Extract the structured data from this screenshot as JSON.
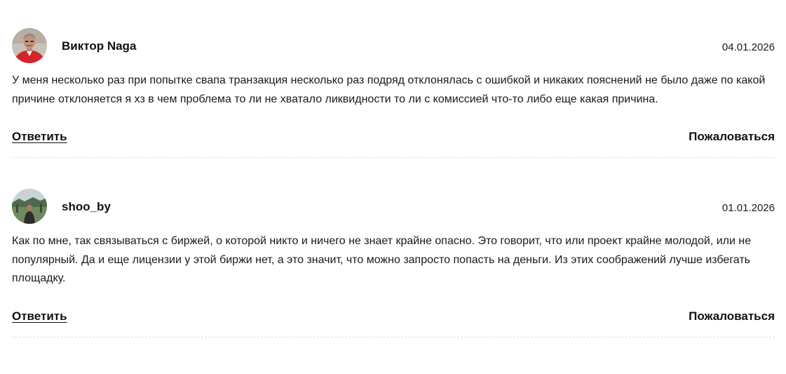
{
  "comments": [
    {
      "author": "Виктор Naga",
      "date": "04.01.2026",
      "text": "У меня несколько раз при попытке свапа транзакция несколько раз подряд отклонялась с ошибкой и никаких пояснений не было даже по какой причине отклоняется я хз в чем проблема то ли не хватало ликвидности то ли с комиссией что-то либо еще какая причина.",
      "reply_label": "Ответить",
      "report_label": "Пожаловаться",
      "avatar_icon": "user-photo-red-shirt"
    },
    {
      "author": "shoo_by",
      "date": "01.01.2026",
      "text": "Как по мне, так связываться с биржей, о которой никто и ничего не знает крайне опасно. Это говорит, что или проект крайне молодой, или не популярный. Да и еще лицензии у этой биржи нет, а это значит, что можно запросто попасть на деньги. Из этих соображений лучше избегать площадку.",
      "reply_label": "Ответить",
      "report_label": "Пожаловаться",
      "avatar_icon": "user-photo-outdoor"
    }
  ]
}
